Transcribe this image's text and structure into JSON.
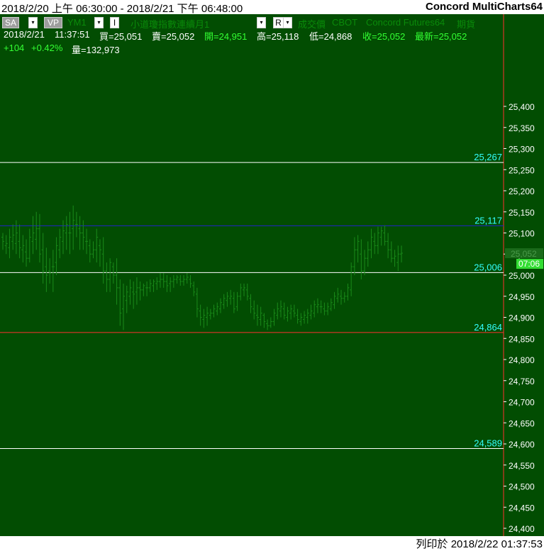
{
  "header": {
    "date_range": "2018/2/20 上午 06:30:00 - 2018/2/21 下午 06:48:00",
    "app_title": "Concord MultiCharts64"
  },
  "toolbar": {
    "sa_label": "SA",
    "dropdown_glyph": "▾",
    "vp_label": "VP",
    "symbol": "YM1",
    "interval_label": "I",
    "symbol_name": "小道瓊指數連續月1",
    "r_label": "R",
    "data_type": "成交價",
    "exchange": "CBOT",
    "data_source": "Concord Futures64",
    "contract_type": "期貨"
  },
  "quote": {
    "date": "2018/2/21",
    "time": "11:37:51",
    "bid": "買=25,051",
    "ask": "賣=25,052",
    "open": "開=24,951",
    "high": "高=25,118",
    "low": "低=24,868",
    "close": "收=25,052",
    "last": "最新=25,052",
    "change": "+104",
    "change_pct": "+0.42%",
    "volume": "量=132,973"
  },
  "price_axis": {
    "min": 24400,
    "max": 25400,
    "step": 50,
    "labels": [
      "25,400",
      "25,350",
      "25,300",
      "25,250",
      "25,200",
      "25,150",
      "25,100",
      "25,050",
      "25,000",
      "24,950",
      "24,900",
      "24,850",
      "24,800",
      "24,750",
      "24,700",
      "24,650",
      "24,600",
      "24,550",
      "24,500",
      "24,450",
      "24,400"
    ]
  },
  "levels": [
    {
      "label": "25,267",
      "value": 25267,
      "color": "#ffffff"
    },
    {
      "label": "25,117",
      "value": 25117,
      "color": "#2222cc"
    },
    {
      "label": "25,006",
      "value": 25006,
      "color": "#ffffff"
    },
    {
      "label": "24,864",
      "value": 24864,
      "color": "#ff3030"
    },
    {
      "label": "24,589",
      "value": 24589,
      "color": "#ffffff"
    }
  ],
  "last_price_tag": {
    "price": "25,052",
    "countdown": "07:06"
  },
  "footer": {
    "printed": "列印於 2018/2/22 01:37:53"
  },
  "colors": {
    "chart_bg": "#024d02",
    "bar": "#1a8a1a",
    "axis_text": "#ffffff",
    "level_text": "#33ffff",
    "up": "#33ff33",
    "down": "#ff3333",
    "divider": "#ff3030"
  },
  "chart_data": {
    "type": "ohlc",
    "bars": [
      [
        25090,
        25100,
        25060,
        25080
      ],
      [
        25070,
        25095,
        25050,
        25075
      ],
      [
        25065,
        25110,
        25040,
        25090
      ],
      [
        25080,
        25120,
        25060,
        25095
      ],
      [
        25075,
        25130,
        25050,
        25100
      ],
      [
        25080,
        25120,
        25040,
        25065
      ],
      [
        25060,
        25095,
        25030,
        25070
      ],
      [
        25055,
        25085,
        25020,
        25040
      ],
      [
        25040,
        25110,
        25030,
        25090
      ],
      [
        25080,
        25140,
        25050,
        25100
      ],
      [
        25085,
        25150,
        25060,
        25110
      ],
      [
        25110,
        25145,
        25030,
        25050
      ],
      [
        25060,
        25100,
        24980,
        25010
      ],
      [
        25020,
        25065,
        24960,
        25000
      ],
      [
        25010,
        25040,
        24980,
        25005
      ],
      [
        25020,
        25060,
        24960,
        25020
      ],
      [
        25030,
        25090,
        25000,
        25070
      ],
      [
        25060,
        25110,
        25040,
        25090
      ],
      [
        25080,
        25130,
        25050,
        25105
      ],
      [
        25100,
        25140,
        25060,
        25120
      ],
      [
        25100,
        25150,
        25050,
        25100
      ],
      [
        25110,
        25165,
        25060,
        25130
      ],
      [
        25120,
        25150,
        25090,
        25120
      ],
      [
        25110,
        25140,
        25060,
        25100
      ],
      [
        25100,
        25130,
        25060,
        25090
      ],
      [
        25080,
        25110,
        25050,
        25080
      ],
      [
        25070,
        25085,
        25030,
        25050
      ],
      [
        25050,
        25080,
        25040,
        25060
      ],
      [
        25060,
        25110,
        25030,
        25090
      ],
      [
        25070,
        25085,
        25020,
        25060
      ],
      [
        25050,
        25090,
        24980,
        25010
      ],
      [
        25010,
        25030,
        24960,
        24990
      ],
      [
        24990,
        25040,
        24960,
        25030
      ],
      [
        25020,
        25030,
        24980,
        25000
      ],
      [
        25000,
        25040,
        24930,
        24970
      ],
      [
        24970,
        24990,
        24880,
        24910
      ],
      [
        24920,
        24980,
        24870,
        24950
      ],
      [
        24940,
        24975,
        24910,
        24960
      ],
      [
        24950,
        24990,
        24930,
        24970
      ],
      [
        24960,
        24985,
        24920,
        24955
      ],
      [
        24960,
        24995,
        24930,
        24970
      ],
      [
        24970,
        24985,
        24940,
        24965
      ],
      [
        24965,
        24980,
        24950,
        24975
      ],
      [
        24970,
        24985,
        24950,
        24970
      ],
      [
        24970,
        24990,
        24960,
        24980
      ],
      [
        24975,
        24990,
        24960,
        24985
      ],
      [
        24980,
        24995,
        24965,
        24985
      ],
      [
        24985,
        25005,
        24970,
        24990
      ],
      [
        24990,
        25005,
        24970,
        24985
      ],
      [
        24985,
        25000,
        24960,
        24975
      ],
      [
        24980,
        24995,
        24960,
        24985
      ],
      [
        24985,
        25000,
        24970,
        24990
      ],
      [
        24990,
        25000,
        24980,
        24995
      ],
      [
        24990,
        25000,
        24975,
        24985
      ],
      [
        24985,
        25000,
        24975,
        24990
      ],
      [
        24990,
        25005,
        24980,
        24995
      ],
      [
        24990,
        25000,
        24970,
        24980
      ],
      [
        24975,
        24985,
        24950,
        24960
      ],
      [
        24955,
        24970,
        24900,
        24920
      ],
      [
        24915,
        24930,
        24880,
        24900
      ],
      [
        24895,
        24920,
        24875,
        24905
      ],
      [
        24900,
        24925,
        24880,
        24910
      ],
      [
        24905,
        24920,
        24895,
        24910
      ],
      [
        24910,
        24930,
        24900,
        24920
      ],
      [
        24915,
        24935,
        24905,
        24925
      ],
      [
        24920,
        24945,
        24910,
        24935
      ],
      [
        24930,
        24955,
        24920,
        24945
      ],
      [
        24940,
        24960,
        24925,
        24950
      ],
      [
        24945,
        24965,
        24930,
        24950
      ],
      [
        24945,
        24960,
        24910,
        24920
      ],
      [
        24925,
        24960,
        24915,
        24950
      ],
      [
        24950,
        24980,
        24940,
        24970
      ],
      [
        24965,
        24980,
        24950,
        24970
      ],
      [
        24965,
        24980,
        24940,
        24950
      ],
      [
        24945,
        24955,
        24910,
        24925
      ],
      [
        24920,
        24940,
        24895,
        24910
      ],
      [
        24905,
        24930,
        24880,
        24900
      ],
      [
        24895,
        24925,
        24880,
        24910
      ],
      [
        24905,
        24910,
        24875,
        24890
      ],
      [
        24885,
        24895,
        24870,
        24880
      ],
      [
        24880,
        24900,
        24875,
        24890
      ],
      [
        24890,
        24920,
        24880,
        24910
      ],
      [
        24905,
        24935,
        24895,
        24920
      ],
      [
        24915,
        24940,
        24900,
        24925
      ],
      [
        24920,
        24935,
        24895,
        24905
      ],
      [
        24900,
        24925,
        24890,
        24915
      ],
      [
        24910,
        24930,
        24895,
        24920
      ],
      [
        24915,
        24930,
        24900,
        24910
      ],
      [
        24905,
        24920,
        24885,
        24895
      ],
      [
        24890,
        24910,
        24880,
        24900
      ],
      [
        24895,
        24915,
        24885,
        24905
      ],
      [
        24900,
        24920,
        24885,
        24910
      ],
      [
        24905,
        24930,
        24895,
        24915
      ],
      [
        24910,
        24940,
        24900,
        24930
      ],
      [
        24925,
        24945,
        24910,
        24930
      ],
      [
        24925,
        24940,
        24910,
        24925
      ],
      [
        24920,
        24935,
        24905,
        24915
      ],
      [
        24915,
        24935,
        24905,
        24925
      ],
      [
        24920,
        24945,
        24915,
        24935
      ],
      [
        24930,
        24960,
        24920,
        24950
      ],
      [
        24945,
        24970,
        24935,
        24955
      ],
      [
        24950,
        24965,
        24930,
        24945
      ],
      [
        24945,
        24960,
        24935,
        24950
      ],
      [
        24950,
        24980,
        24940,
        24970
      ],
      [
        24965,
        25030,
        24950,
        25020
      ],
      [
        25020,
        25090,
        25000,
        25060
      ],
      [
        25060,
        25095,
        25030,
        25080
      ],
      [
        25050,
        25085,
        24990,
        25010
      ],
      [
        25010,
        25060,
        25000,
        25040
      ],
      [
        25040,
        25080,
        25020,
        25060
      ],
      [
        25060,
        25110,
        25040,
        25090
      ],
      [
        25080,
        25100,
        25050,
        25070
      ],
      [
        25070,
        25115,
        25050,
        25100
      ],
      [
        25090,
        25115,
        25070,
        25105
      ],
      [
        25100,
        25118,
        25070,
        25080
      ],
      [
        25080,
        25100,
        25040,
        25060
      ],
      [
        25060,
        25080,
        25030,
        25040
      ],
      [
        25040,
        25060,
        25020,
        25045
      ],
      [
        25030,
        25070,
        25010,
        25050
      ],
      [
        25050,
        25070,
        25030,
        25052
      ]
    ]
  }
}
